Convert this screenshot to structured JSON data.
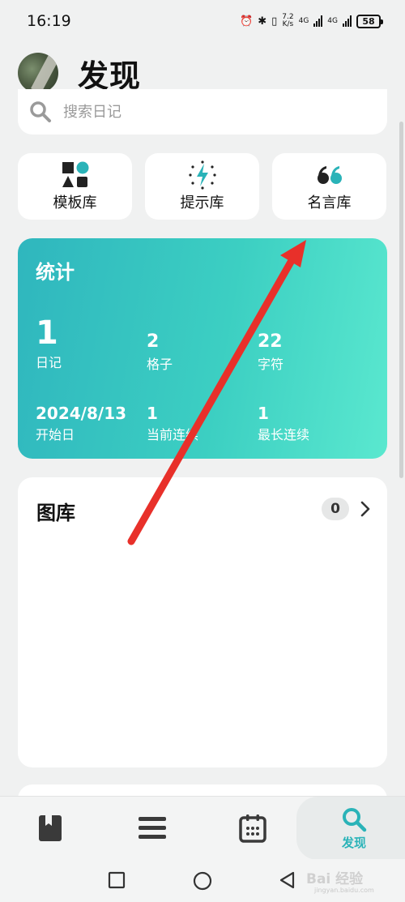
{
  "status_bar": {
    "time": "16:19",
    "speed_value": "7.2",
    "speed_unit": "K/s",
    "network_1": "4G",
    "network_2": "4G",
    "battery": "58"
  },
  "header": {
    "title": "发现"
  },
  "search": {
    "placeholder": "搜索日记"
  },
  "libraries": [
    {
      "label": "模板库",
      "icon": "shapes-icon"
    },
    {
      "label": "提示库",
      "icon": "lightning-spark-icon"
    },
    {
      "label": "名言库",
      "icon": "quote-icon"
    }
  ],
  "stats": {
    "title": "统计",
    "diary_count": "1",
    "diary_label": "日记",
    "grid_count": "2",
    "grid_label": "格子",
    "char_count": "22",
    "char_label": "字符",
    "start_date": "2024/8/13",
    "start_label": "开始日",
    "current_streak": "1",
    "current_streak_label": "当前连续",
    "longest_streak": "1",
    "longest_streak_label": "最长连续"
  },
  "gallery": {
    "title": "图库",
    "count": "0"
  },
  "bottom_nav": {
    "items": [
      {
        "name": "diary",
        "icon": "bookmark-book-icon",
        "label": ""
      },
      {
        "name": "list",
        "icon": "menu-lines-icon",
        "label": ""
      },
      {
        "name": "calendar",
        "icon": "calendar-icon",
        "label": ""
      },
      {
        "name": "discover",
        "icon": "search-icon",
        "label": "发现"
      }
    ],
    "accent_color": "#2ab3b8"
  },
  "colors": {
    "stats_gradient_start": "#2fb6be",
    "stats_gradient_end": "#5ae8cf",
    "annotation_arrow": "#e8302a"
  },
  "watermark": {
    "text": "Bai 经验",
    "sub": "jingyan.baidu.com"
  }
}
